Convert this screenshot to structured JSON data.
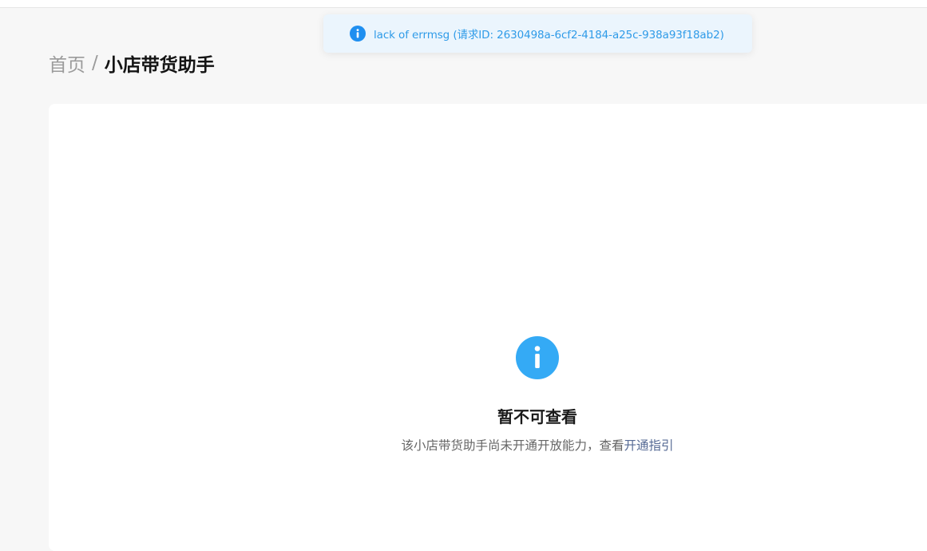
{
  "toast": {
    "icon": "info-icon",
    "message": "lack of errmsg (请求ID: 2630498a-6cf2-4184-a25c-938a93f18ab2)",
    "color": "#2f9be8",
    "background": "#ebf5fd"
  },
  "breadcrumb": {
    "home": "首页",
    "separator": "/",
    "current": "小店带货助手"
  },
  "empty_state": {
    "icon": "info-icon",
    "icon_color": "#34aaf5",
    "title": "暂不可查看",
    "description": "该小店带货助手尚未开通开放能力，查看",
    "link_label": "开通指引",
    "link_color": "#576b95"
  }
}
